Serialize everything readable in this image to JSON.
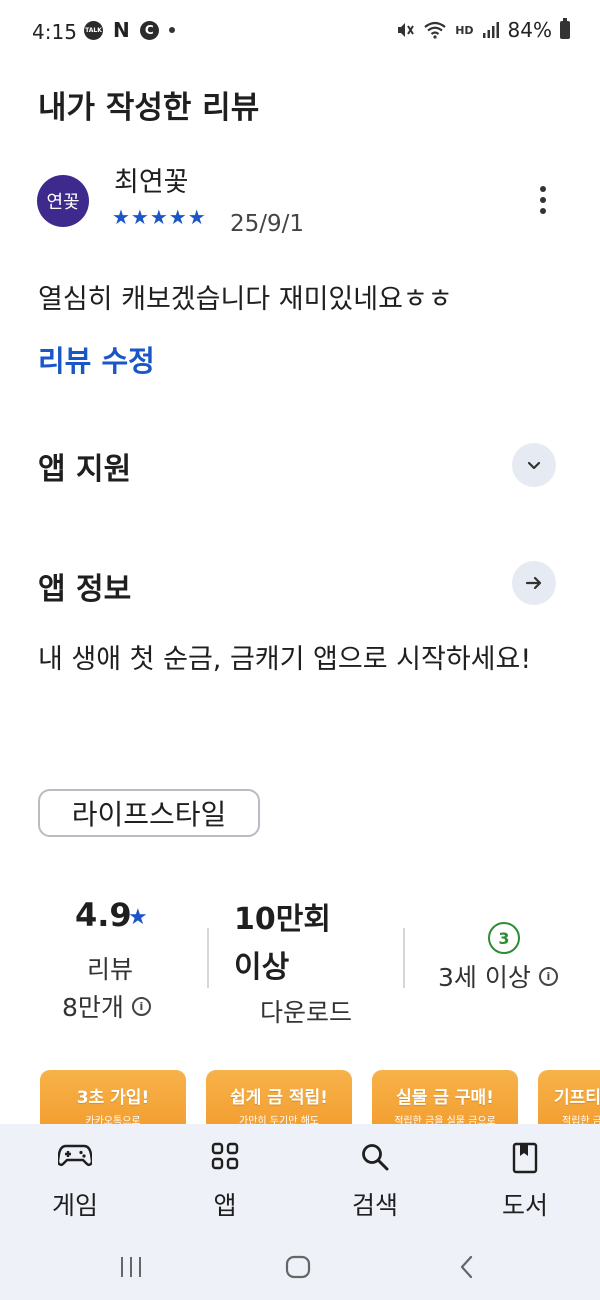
{
  "status_bar": {
    "time": "4:15",
    "left_icons": [
      "kakaotalk-icon",
      "naver-icon",
      "c-icon",
      "dot-icon"
    ],
    "talk_label": "TALK",
    "n_label": "N",
    "c_label": "C",
    "hd_label": "HD",
    "battery": "84%"
  },
  "page_title": "내가 작성한 리뷰",
  "review": {
    "avatar_text": "연꽃",
    "author": "최연꽃",
    "stars": "★★★★★",
    "date": "25/9/1",
    "text": "열심히 캐보겠습니다 재미있네요ㅎㅎ",
    "edit_label": "리뷰 수정"
  },
  "app_support": {
    "title": "앱 지원"
  },
  "app_info": {
    "title": "앱 정보",
    "description": "내 생애 첫 순금, 금캐기 앱으로 시작하세요!",
    "category": "라이프스타일"
  },
  "stats": {
    "rating": "4.9",
    "rating_star": "★",
    "reviews_label": "리뷰",
    "reviews_count": "8만개",
    "downloads_line1": "10만회",
    "downloads_line2": "이상",
    "downloads_label": "다운로드",
    "age_badge": "3",
    "age_label": "3세 이상",
    "info_glyph": "i"
  },
  "screenshots": [
    {
      "title": "3초 가입!",
      "subtitle": "카카오톡으로"
    },
    {
      "title": "쉽게 금 적립!",
      "subtitle": "가만히 두기만 해도"
    },
    {
      "title": "실물 금 구매!",
      "subtitle": "적립한 금을 실물 금으로"
    },
    {
      "title": "기프티",
      "subtitle": "적립한 금"
    }
  ],
  "bottom_nav": {
    "items": [
      {
        "label": "게임",
        "icon": "gamepad-icon"
      },
      {
        "label": "앱",
        "icon": "apps-grid-icon"
      },
      {
        "label": "검색",
        "icon": "search-icon"
      },
      {
        "label": "도서",
        "icon": "book-icon"
      }
    ]
  },
  "colors": {
    "accent_blue": "#1a56c8",
    "avatar_purple": "#3d2a8c",
    "age_green": "#2e8b36",
    "nav_background": "#eef1f7",
    "screenshot_orange": "#f29a2a"
  }
}
